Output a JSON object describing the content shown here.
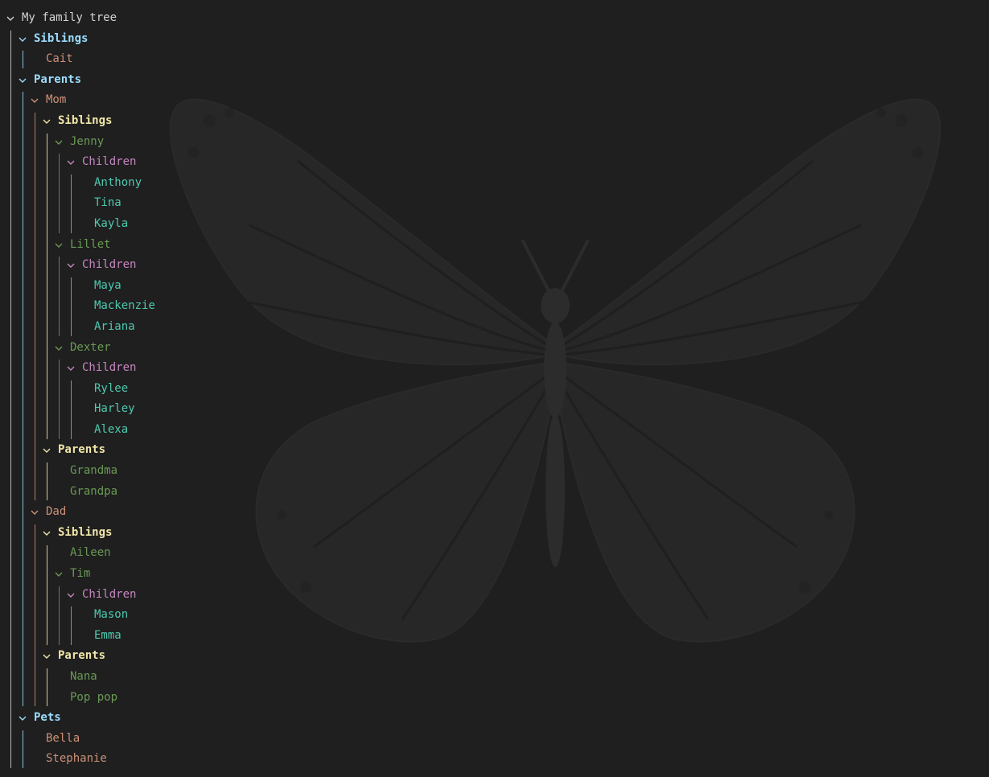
{
  "colors": {
    "background": "#1f1f1f",
    "levels": [
      "#d4d4d4",
      "#9cdcfe",
      "#ce9178",
      "#f0e6a8",
      "#6a9955",
      "#c586c0",
      "#4ec9b0"
    ]
  },
  "background_image": {
    "icon": "butterfly-icon"
  },
  "tree": {
    "label": "My family tree",
    "children": [
      {
        "label": "Siblings",
        "children": [
          {
            "label": "Cait"
          }
        ]
      },
      {
        "label": "Parents",
        "children": [
          {
            "label": "Mom",
            "children": [
              {
                "label": "Siblings",
                "children": [
                  {
                    "label": "Jenny",
                    "children": [
                      {
                        "label": "Children",
                        "children": [
                          {
                            "label": "Anthony"
                          },
                          {
                            "label": "Tina"
                          },
                          {
                            "label": "Kayla"
                          }
                        ]
                      }
                    ]
                  },
                  {
                    "label": "Lillet",
                    "children": [
                      {
                        "label": "Children",
                        "children": [
                          {
                            "label": "Maya"
                          },
                          {
                            "label": "Mackenzie"
                          },
                          {
                            "label": "Ariana"
                          }
                        ]
                      }
                    ]
                  },
                  {
                    "label": "Dexter",
                    "children": [
                      {
                        "label": "Children",
                        "children": [
                          {
                            "label": "Rylee"
                          },
                          {
                            "label": "Harley"
                          },
                          {
                            "label": "Alexa"
                          }
                        ]
                      }
                    ]
                  }
                ]
              },
              {
                "label": "Parents",
                "children": [
                  {
                    "label": "Grandma"
                  },
                  {
                    "label": "Grandpa"
                  }
                ]
              }
            ]
          },
          {
            "label": "Dad",
            "children": [
              {
                "label": "Siblings",
                "children": [
                  {
                    "label": "Aileen"
                  },
                  {
                    "label": "Tim",
                    "children": [
                      {
                        "label": "Children",
                        "children": [
                          {
                            "label": "Mason"
                          },
                          {
                            "label": "Emma"
                          }
                        ]
                      }
                    ]
                  }
                ]
              },
              {
                "label": "Parents",
                "children": [
                  {
                    "label": "Nana"
                  },
                  {
                    "label": "Pop pop"
                  }
                ]
              }
            ]
          }
        ]
      },
      {
        "label": "Pets",
        "children": [
          {
            "label": "Bella"
          },
          {
            "label": "Stephanie"
          }
        ]
      }
    ]
  }
}
